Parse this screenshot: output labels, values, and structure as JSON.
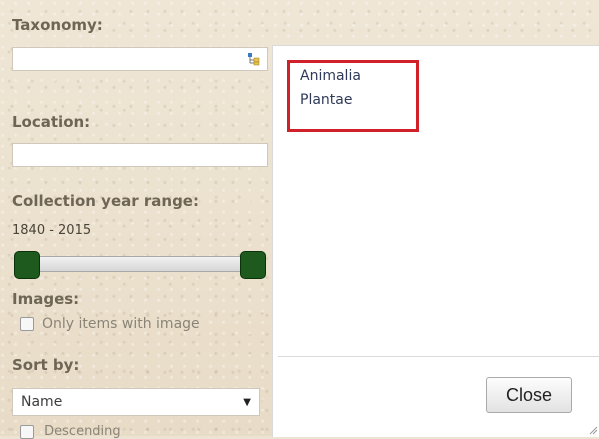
{
  "sidebar": {
    "taxonomy_label": "Taxonomy:",
    "taxonomy_value": "",
    "location_label": "Location:",
    "location_value": "",
    "year_range_label": "Collection year range:",
    "year_range_text": "1840 - 2015",
    "year_range": {
      "min": 1840,
      "max": 2015
    },
    "images_label": "Images:",
    "only_images_label": "Only items with image",
    "only_images_checked": false,
    "sort_label": "Sort by:",
    "sort_value": "Name",
    "descending_label": "Descending",
    "descending_checked": false
  },
  "popup": {
    "items": [
      "Animalia",
      "Plantae"
    ],
    "close_label": "Close",
    "highlight_color": "#d0202a"
  },
  "icons": {
    "taxonomy_picker": "tree-icon",
    "select_arrow": "chevron-down-icon",
    "resize": "resize-grip-icon"
  }
}
